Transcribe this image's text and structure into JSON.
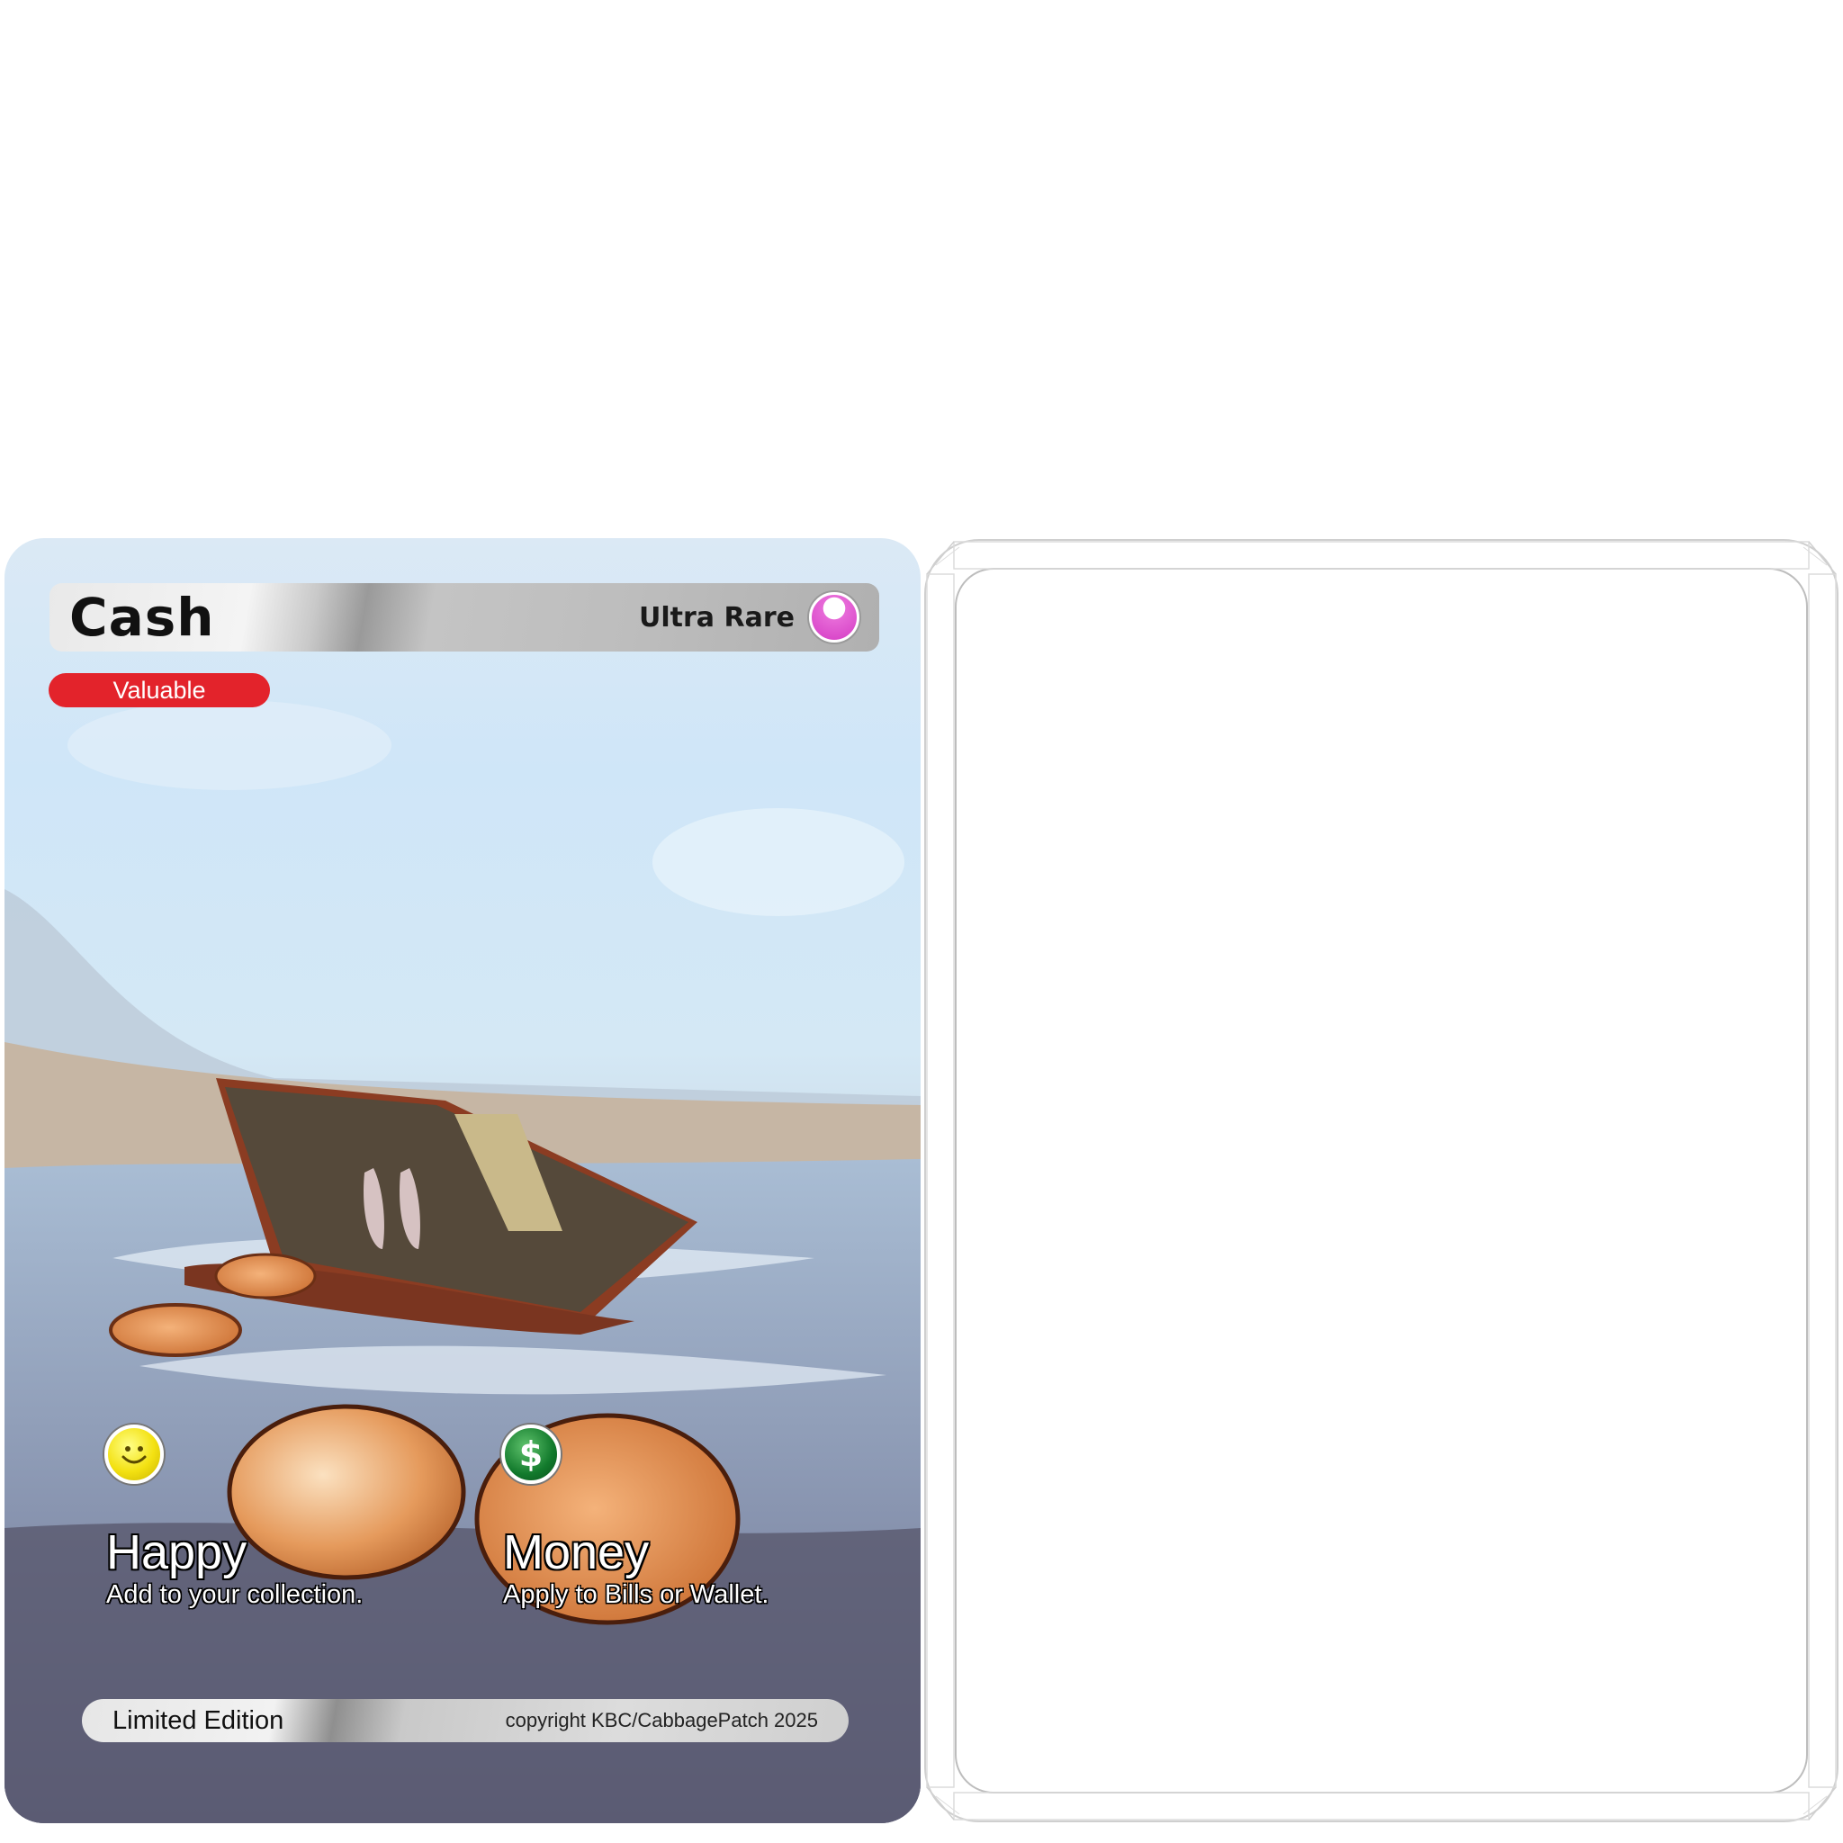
{
  "card": {
    "name": "Cash",
    "rarity": "Ultra Rare",
    "rarity_color": "#d43cc4",
    "type": "Valuable",
    "type_color": "#e3232b",
    "stats": [
      {
        "icon": "smiley-icon",
        "title": "Happy",
        "description": "Add to your collection."
      },
      {
        "icon": "dollar-coin-icon",
        "icon_text": "$",
        "title": "Money",
        "description": "Apply to Bills or Wallet."
      }
    ],
    "edition": "Limited Edition",
    "copyright": "copyright KBC/CabbagePatch 2025"
  }
}
